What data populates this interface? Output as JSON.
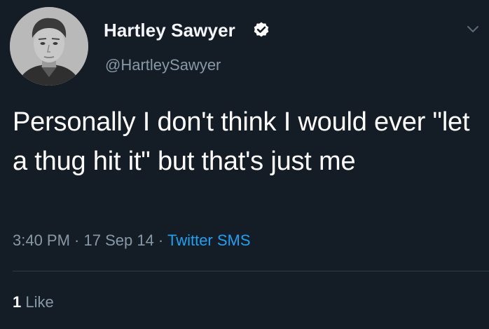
{
  "tweet": {
    "author": {
      "display_name": "Hartley Sawyer",
      "handle": "@HartleySawyer",
      "verified": true,
      "avatar_icon": "profile-photo"
    },
    "text": "Personally I don't think I would ever \"let a thug hit it\" but that's just me",
    "meta": {
      "time": "3:40 PM",
      "separator": " · ",
      "date": "17 Sep 14",
      "source": "Twitter SMS"
    },
    "likes": {
      "count": "1",
      "label": "Like"
    }
  },
  "colors": {
    "background": "#141c26",
    "muted_text": "#8899a6",
    "link": "#1da1f2",
    "text": "#ffffff"
  }
}
